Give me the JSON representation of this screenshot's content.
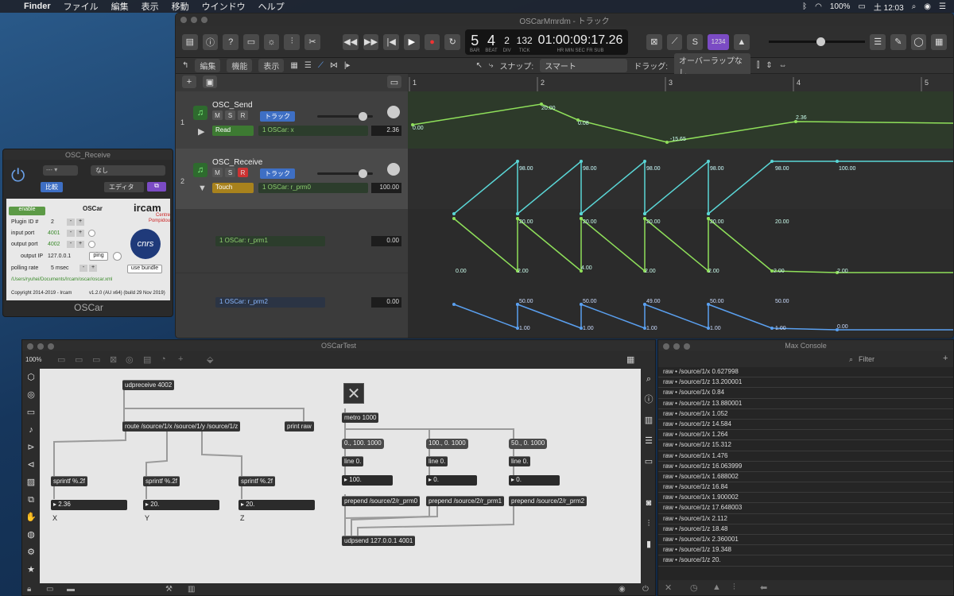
{
  "menubar": {
    "app": "Finder",
    "items": [
      "ファイル",
      "編集",
      "表示",
      "移動",
      "ウインドウ",
      "ヘルプ"
    ],
    "battery": "100%",
    "clock": "土 12:03"
  },
  "logic": {
    "window_title": "OSCarMmrdm - トラック",
    "lcd": {
      "bar": "5",
      "beat": "4",
      "div": "2",
      "tick": "132",
      "time": "01:00:09:17.26",
      "labels": [
        "BAR",
        "BEAT",
        "DIV",
        "TICK",
        "HR",
        "MIN",
        "SEC",
        "FR",
        "SUB"
      ]
    },
    "toolbar": {
      "edit": "編集",
      "functions": "機能",
      "view": "表示",
      "snap_label": "スナップ:",
      "snap_value": "スマート",
      "drag_label": "ドラッグ:",
      "drag_value": "オーバーラップなし",
      "key_badge": "1234"
    },
    "ruler": [
      "1",
      "2",
      "3",
      "4",
      "5"
    ],
    "tracks": [
      {
        "num": "1",
        "name": "OSC_Send",
        "mode": "Read",
        "param": "1 OSCar: x",
        "value": "2.36",
        "btn": "トラック"
      },
      {
        "num": "2",
        "name": "OSC_Receive",
        "mode": "Touch",
        "param": "1 OSCar: r_prm0",
        "value": "100.00",
        "btn": "トラック"
      }
    ],
    "lanes": [
      {
        "param": "1 OSCar: r_prm1",
        "value": "0.00"
      },
      {
        "param": "1 OSCar: r_prm2",
        "value": "0.00"
      }
    ],
    "msr": [
      "M",
      "S",
      "R"
    ],
    "lane1_labels": [
      "0.00",
      "20.00",
      "0.08",
      "-15.65",
      "2.36"
    ],
    "lane2_labels": [
      "98.00",
      "98.00",
      "98.00",
      "98.00",
      "98.00",
      "100.00"
    ],
    "lane3_labels": [
      "20.00",
      "20.00",
      "20.00",
      "20.00",
      "20.00",
      "0.00",
      "2.00",
      "4.00",
      "2.00",
      "2.00",
      "2.00",
      "2.00"
    ],
    "lane4_labels": [
      "50.00",
      "50.00",
      "49.00",
      "50.00",
      "50.00",
      "1.00",
      "1.00",
      "1.00",
      "1.00",
      "1.00",
      "0.00"
    ]
  },
  "osc_receive": {
    "title": "OSC_Receive",
    "preset": "なし",
    "compare": "比較",
    "editor": "エディタ",
    "plugin_title": "OSCar",
    "enable": "enable",
    "plugin_id_label": "Plugin ID #",
    "plugin_id": "2",
    "input_port_label": "input port",
    "input_port": "4001",
    "output_port_label": "output port",
    "output_port": "4002",
    "output_ip_label": "output IP",
    "output_ip": "127.0.0.1",
    "ping": "ping",
    "polling_label": "polling rate",
    "polling": "5 msec",
    "use_bundle": "use bundle",
    "path": "/Users/ryuhei/Documents/Ircam/oscar/oscar.xml",
    "copyright": "Copyright 2014-2019 - Ircam",
    "version": "v1.2.0 (AU  x64)  (build 29 Nov 2019)",
    "brand": "ircam",
    "brand_sub": "Centre Pompidou",
    "cnrs": "cnrs",
    "footer": "OSCar"
  },
  "max_patch": {
    "title": "OSCarTest",
    "zoom": "100%",
    "objects": {
      "udpreceive": "udpreceive 4002",
      "route": "route /source/1/x /source/1/y /source/1/z",
      "print": "print raw",
      "sprintf_x": "sprintf %.2f",
      "sprintf_y": "sprintf %.2f",
      "sprintf_z": "sprintf %.2f",
      "metro": "metro 1000",
      "msg0": "0., 100. 1000",
      "msg1": "100., 0. 1000",
      "msg2": "50., 0. 1000",
      "line0": "line 0.",
      "line1": "line 0.",
      "line2": "line 0.",
      "prepend0": "prepend /source/2/r_prm0",
      "prepend1": "prepend /source/2/r_prm1",
      "prepend2": "prepend /source/2/r_prm2",
      "udpsend": "udpsend 127.0.0.1 4001"
    },
    "numbers": {
      "x_out": "2.36",
      "y_out": "20.",
      "z_out": "20.",
      "n0": "100.",
      "n1": "0.",
      "n2": "0."
    },
    "axis_labels": [
      "X",
      "Y",
      "Z"
    ]
  },
  "console": {
    "title": "Max Console",
    "filter": "Filter",
    "lines": [
      "raw • /source/1/x 0.627998",
      "raw • /source/1/z 13.200001",
      "raw • /source/1/x 0.84",
      "raw • /source/1/z 13.880001",
      "raw • /source/1/x 1.052",
      "raw • /source/1/z 14.584",
      "raw • /source/1/x 1.264",
      "raw • /source/1/z 15.312",
      "raw • /source/1/x 1.476",
      "raw • /source/1/z 16.063999",
      "raw • /source/1/x 1.688002",
      "raw • /source/1/z 16.84",
      "raw • /source/1/x 1.900002",
      "raw • /source/1/z 17.648003",
      "raw • /source/1/x 2.112",
      "raw • /source/1/z 18.48",
      "raw • /source/1/x 2.360001",
      "raw • /source/1/z 19.348",
      "raw • /source/1/z 20."
    ]
  }
}
